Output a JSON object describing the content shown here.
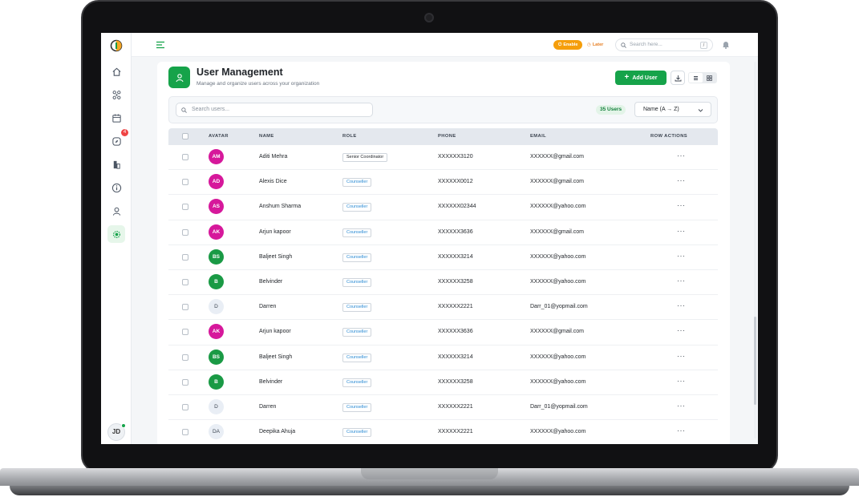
{
  "topbar": {
    "enable_label": "Enable",
    "later_label": "Later",
    "search_placeholder": "Search here...",
    "search_shortcut": "/"
  },
  "header": {
    "title": "User Management",
    "subtitle": "Manage and organize users across your organization",
    "add_user_label": "Add User"
  },
  "filters": {
    "search_placeholder": "Search users...",
    "count_label": "35 Users",
    "sort_value": "Name (A → Z)"
  },
  "sidebar": {
    "notification_count": "4",
    "user_initials": "JD"
  },
  "table": {
    "columns": [
      "AVATAR",
      "NAME",
      "ROLE",
      "PHONE",
      "EMAIL",
      "ROW ACTIONS"
    ],
    "rows": [
      {
        "initials": "AM",
        "avatar_color": "#d6189b",
        "name": "Aditi Mehra",
        "role": "Senior Coordinator",
        "role_color": "#1f2328",
        "phone": "XXXXXX3120",
        "email": "XXXXXX@gmail.com",
        "actions": "···"
      },
      {
        "initials": "AD",
        "avatar_color": "#d6189b",
        "name": "Alexis Dice",
        "role": "Counseller",
        "role_color": "#2a8bd4",
        "phone": "XXXXXX0012",
        "email": "XXXXXX@gmail.com",
        "actions": "···"
      },
      {
        "initials": "AS",
        "avatar_color": "#d6189b",
        "name": "Anshum Sharma",
        "role": "Counseller",
        "role_color": "#2a8bd4",
        "phone": "XXXXXX02344",
        "email": "XXXXXX@yahoo.com",
        "actions": "···"
      },
      {
        "initials": "AK",
        "avatar_color": "#d6189b",
        "name": "Arjun kapoor",
        "role": "Counseller",
        "role_color": "#2a8bd4",
        "phone": "XXXXXX3636",
        "email": "XXXXXX@gmail.com",
        "actions": "···"
      },
      {
        "initials": "BS",
        "avatar_color": "#1a9a45",
        "name": "Baljeet Singh",
        "role": "Counseller",
        "role_color": "#2a8bd4",
        "phone": "XXXXXX3214",
        "email": "XXXXXX@yahoo.com",
        "actions": "···"
      },
      {
        "initials": "B",
        "avatar_color": "#1a9a45",
        "name": "Belvinder",
        "role": "Counseller",
        "role_color": "#2a8bd4",
        "phone": "XXXXXX3258",
        "email": "XXXXXX@yahoo.com",
        "actions": "···"
      },
      {
        "initials": "D",
        "avatar_color": "#e9eef5",
        "name": "Darren",
        "role": "Counseller",
        "role_color": "#2a8bd4",
        "phone": "XXXXXX2221",
        "email": "Darr_01@yopmail.com",
        "actions": "···"
      },
      {
        "initials": "AK",
        "avatar_color": "#d6189b",
        "name": "Arjun kapoor",
        "role": "Counseller",
        "role_color": "#2a8bd4",
        "phone": "XXXXXX3636",
        "email": "XXXXXX@gmail.com",
        "actions": "···"
      },
      {
        "initials": "BS",
        "avatar_color": "#1a9a45",
        "name": "Baljeet Singh",
        "role": "Counseller",
        "role_color": "#2a8bd4",
        "phone": "XXXXXX3214",
        "email": "XXXXXX@yahoo.com",
        "actions": "···"
      },
      {
        "initials": "B",
        "avatar_color": "#1a9a45",
        "name": "Belvinder",
        "role": "Counseller",
        "role_color": "#2a8bd4",
        "phone": "XXXXXX3258",
        "email": "XXXXXX@yahoo.com",
        "actions": "···"
      },
      {
        "initials": "D",
        "avatar_color": "#e9eef5",
        "name": "Darren",
        "role": "Counseller",
        "role_color": "#2a8bd4",
        "phone": "XXXXXX2221",
        "email": "Darr_01@yopmail.com",
        "actions": "···"
      },
      {
        "initials": "DA",
        "avatar_color": "#e9eef5",
        "name": "Deepika Ahuja",
        "role": "Counseller",
        "role_color": "#2a8bd4",
        "phone": "XXXXXX2221",
        "email": "XXXXXX@yahoo.com",
        "actions": "···"
      }
    ]
  },
  "colors": {
    "accent_green": "#16a34a",
    "warning_orange": "#f59e0b",
    "magenta_avatar": "#d6189b",
    "green_avatar": "#1a9a45"
  }
}
